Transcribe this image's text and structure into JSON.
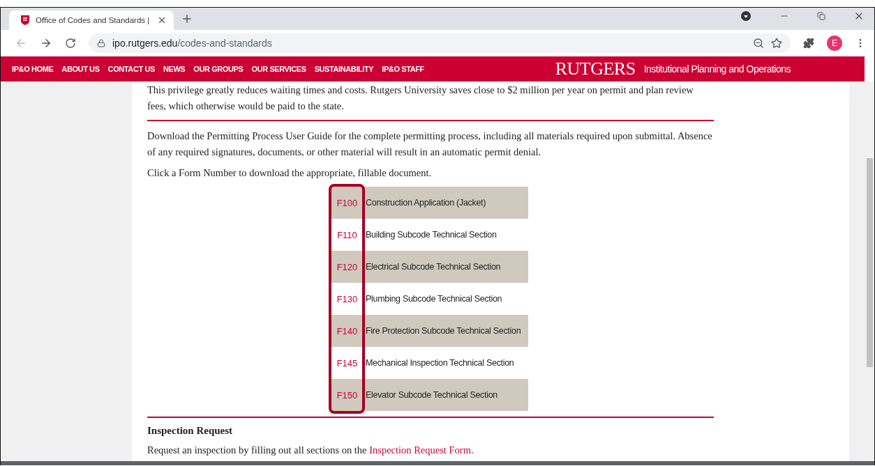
{
  "browser": {
    "tab_title": "Office of Codes and Standards |",
    "url_host": "ipo.rutgers.edu",
    "url_path": "/codes-and-standards",
    "profile_initial": "E"
  },
  "nav": {
    "items": [
      "IP&O HOME",
      "ABOUT US",
      "CONTACT US",
      "NEWS",
      "OUR GROUPS",
      "OUR SERVICES",
      "SUSTAINABILITY",
      "IP&O STAFF"
    ],
    "logo": "RUTGERS",
    "subtitle": "Institutional Planning and Operations"
  },
  "content": {
    "intro": "This privilege greatly reduces waiting times and costs. Rutgers University saves close to $2 million per year on permit and plan review fees, which otherwise would be paid to the state.",
    "guide": "Download the Permitting Process User Guide for the complete permitting process, including all materials required upon submittal. Absence of any required signatures, documents, or other material will result in an automatic permit denial.",
    "instruction": "Click a Form Number to download the appropriate, fillable document.",
    "forms": {
      "code_column_highlighted": true,
      "rows": [
        {
          "code": "F100",
          "title": "Construction Application (Jacket)"
        },
        {
          "code": "F110",
          "title": "Building Subcode Technical Section"
        },
        {
          "code": "F120",
          "title": "Electrical Subcode Technical Section"
        },
        {
          "code": "F130",
          "title": "Plumbing Subcode Technical Section"
        },
        {
          "code": "F140",
          "title": "Fire Protection Subcode Technical Section"
        },
        {
          "code": "F145",
          "title": "Mechanical Inspection Technical Section"
        },
        {
          "code": "F150",
          "title": "Elevator Subcode Technical Section"
        }
      ]
    },
    "inspection": {
      "heading": "Inspection Request",
      "text": "Request an inspection by filling out all sections on the ",
      "link": "Inspection Request Form."
    }
  }
}
